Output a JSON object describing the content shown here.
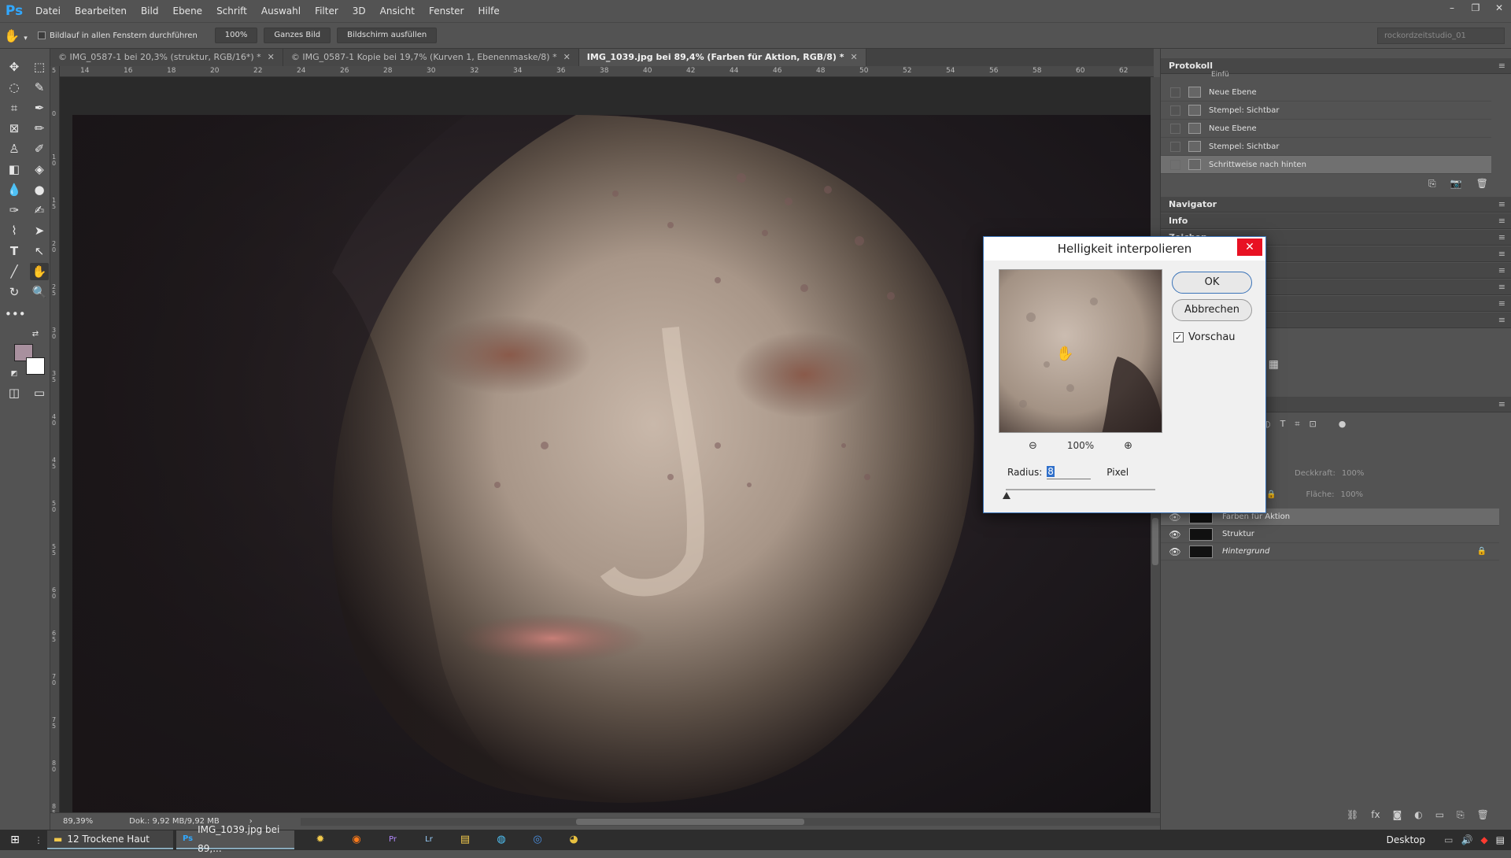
{
  "app": {
    "logo": "Ps"
  },
  "menu": [
    "Datei",
    "Bearbeiten",
    "Bild",
    "Ebene",
    "Schrift",
    "Auswahl",
    "Filter",
    "3D",
    "Ansicht",
    "Fenster",
    "Hilfe"
  ],
  "window_controls": [
    "–",
    "❐",
    "✕"
  ],
  "options_bar": {
    "scroll_all_label": "Bildlauf in allen Fenstern durchführen",
    "zoom_100": "100%",
    "fit_screen": "Ganzes Bild",
    "fill_screen": "Bildschirm ausfüllen",
    "workspace": "rockordzeitstudio_01"
  },
  "doc_tabs": [
    {
      "label": "© IMG_0587-1 bei 20,3% (struktur, RGB/16*) *",
      "active": false
    },
    {
      "label": "© IMG_0587-1 Kopie bei 19,7% (Kurven 1, Ebenenmaske/8) *",
      "active": false
    },
    {
      "label": "IMG_1039.jpg bei 89,4% (Farben für Aktion, RGB/8) *",
      "active": true
    }
  ],
  "ruler_h": [
    "14",
    "16",
    "18",
    "20",
    "22",
    "24",
    "26",
    "28",
    "30",
    "32",
    "34",
    "36",
    "38",
    "40",
    "42",
    "44",
    "46",
    "48",
    "50",
    "52",
    "54",
    "56",
    "58",
    "60",
    "62"
  ],
  "ruler_v": [
    "5",
    "0",
    "1 0",
    "1 5",
    "2 0",
    "2 5",
    "3 0",
    "3 5",
    "4 0",
    "4 5",
    "5 0",
    "5 5",
    "6 0",
    "6 5",
    "7 0",
    "7 5",
    "8 0",
    "8 5"
  ],
  "status": {
    "zoom": "89,39%",
    "doc": "Dok.: 9,92 MB/9,92 MB"
  },
  "panels": {
    "history_title": "Protokoll",
    "history_items": [
      "Neue Ebene",
      "Stempel: Sichtbar",
      "Neue Ebene",
      "Stempel: Sichtbar",
      "Schrittweise nach hinten"
    ],
    "history_cut_item": "Einfü",
    "navigator": "Navigator",
    "info": "Info",
    "zeichen": "Zeichen",
    "opacity_label": "Deckkraft:",
    "opacity_value": "100%",
    "fill_label": "Fläche:",
    "fill_value": "100%",
    "layers": [
      {
        "name": "Farben für Aktion",
        "selected": true
      },
      {
        "name": "Struktur",
        "selected": false
      },
      {
        "name": "Hintergrund",
        "selected": false
      }
    ]
  },
  "dialog": {
    "title": "Helligkeit interpolieren",
    "ok": "OK",
    "cancel": "Abbrechen",
    "preview_label": "Vorschau",
    "zoom": "100%",
    "radius_label": "Radius:",
    "radius_value": "8",
    "unit": "Pixel"
  },
  "taskbar": {
    "items": [
      "12 Trockene Haut",
      "IMG_1039.jpg bei 89,..."
    ],
    "desktop": "Desktop"
  },
  "colors": {
    "foreground": "#a8909e",
    "background": "#ffffff",
    "accent": "#31a8ff"
  }
}
